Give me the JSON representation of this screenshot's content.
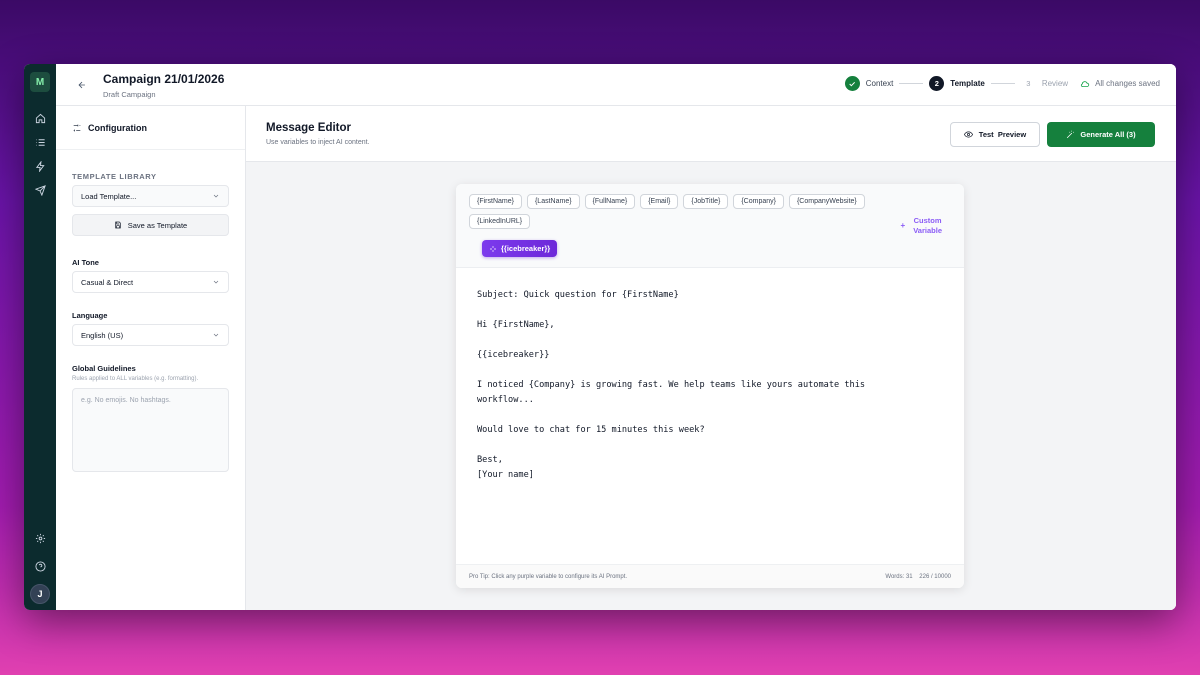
{
  "rail": {
    "logo": "M",
    "avatar": "J",
    "icons": [
      "home-icon",
      "list-icon",
      "zap-icon",
      "send-icon",
      "settings-icon",
      "help-icon"
    ]
  },
  "header": {
    "title": "Campaign 21/01/2026",
    "subtitle": "Draft Campaign",
    "steps": [
      {
        "number": "",
        "label": "Context",
        "state": "done"
      },
      {
        "number": "2",
        "label": "Template",
        "state": "active"
      },
      {
        "number": "3",
        "label": "Review",
        "state": "todo"
      }
    ],
    "saved_status": "All changes saved"
  },
  "sidebar": {
    "heading": "Configuration",
    "template_library_title": "TEMPLATE LIBRARY",
    "load_template": "Load Template...",
    "save_template": "Save as Template",
    "ai_tone_label": "AI Tone",
    "ai_tone_value": "Casual & Direct",
    "language_label": "Language",
    "language_value": "English (US)",
    "guidelines_label": "Global Guidelines",
    "guidelines_hint": "Rules applied to ALL variables (e.g. formatting).",
    "guidelines_placeholder": "e.g. No emojis. No hashtags."
  },
  "editor": {
    "title": "Message Editor",
    "subtitle": "Use variables to inject AI content.",
    "test_preview": "Test  Preview",
    "generate_all": "Generate All (3)",
    "variables": [
      "{FirstName}",
      "{LastName}",
      "{FullName}",
      "{Email}",
      "{JobTitle}",
      "{Company}",
      "{CompanyWebsite}",
      "{LinkedInURL}"
    ],
    "ai_variable": "{{icebreaker}}",
    "custom_variable": "Custom Variable",
    "custom_variable_line1": "Custom",
    "custom_variable_line2": "Variable",
    "lines": [
      "Subject: Quick question for {FirstName}",
      "",
      "Hi {FirstName},",
      "",
      "{{icebreaker}}",
      "",
      "I noticed {Company} is growing fast. We help teams like yours automate this",
      "workflow...",
      "",
      "Would love to chat for 15 minutes this week?",
      "",
      "Best,",
      "[Your name]"
    ],
    "pro_tip": "Pro Tip: Click any purple variable to configure its AI Prompt.",
    "word_count": "Words: 31",
    "char_count": "226 / 10000"
  },
  "colors": {
    "accent_green": "#15803d",
    "ai_purple": "#7c3aed",
    "rail_bg": "#0c2b2e"
  }
}
